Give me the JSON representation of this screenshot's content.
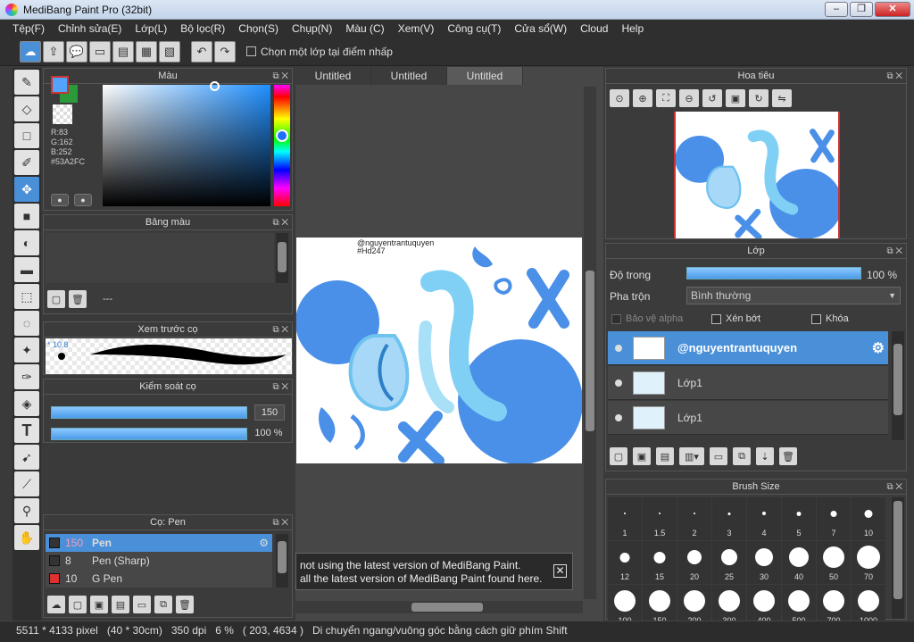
{
  "app": {
    "title": "MediBang Paint Pro (32bit)"
  },
  "menu": [
    "Tệp(F)",
    "Chỉnh sửa(E)",
    "Lớp(L)",
    "Bộ lọc(R)",
    "Chọn(S)",
    "Chụp(N)",
    "Màu (C)",
    "Xem(V)",
    "Công cụ(T)",
    "Cửa sổ(W)",
    "Cloud",
    "Help"
  ],
  "toolbar": {
    "select_layer_label": "Chọn một lớp tại điểm nhấp"
  },
  "panels": {
    "color": {
      "title": "Màu",
      "r": "R:83",
      "g": "G:162",
      "b": "B:252",
      "hex": "#53A2FC",
      "fg_color": "#53a2fc",
      "bg_color": "#2a9a3a"
    },
    "palette": {
      "title": "Bảng màu",
      "info": "---"
    },
    "brush_preview": {
      "title": "Xem trước cọ",
      "size": "* 10.8"
    },
    "brush_control": {
      "title": "Kiểm soát cọ",
      "size_value": "150",
      "opacity_value": "100 %",
      "size_fill": 1.0,
      "opacity_fill": 1.0
    },
    "brush_list": {
      "title": "Cọ: Pen",
      "items": [
        {
          "size": "150",
          "name": "Pen",
          "color": "#333333"
        },
        {
          "size": "8",
          "name": "Pen (Sharp)",
          "color": "#333333"
        },
        {
          "size": "10",
          "name": "G Pen",
          "color": "#e03030"
        }
      ]
    },
    "navigator": {
      "title": "Hoa tiêu"
    },
    "layer": {
      "title": "Lớp",
      "opacity_label": "Độ trong",
      "opacity_value": "100 %",
      "blend_label": "Pha trộn",
      "blend_value": "Bình thường",
      "protect_alpha": "Bảo vệ alpha",
      "clipping": "Xén bớt",
      "lock": "Khóa",
      "rows": [
        {
          "name": "@nguyentrantuquyen"
        },
        {
          "name": "Lớp1"
        },
        {
          "name": "Lớp1"
        }
      ]
    },
    "brush_size": {
      "title": "Brush Size",
      "sizes": [
        "1",
        "1.5",
        "2",
        "3",
        "4",
        "5",
        "7",
        "10",
        "12",
        "15",
        "20",
        "25",
        "30",
        "40",
        "50",
        "70",
        "100",
        "150",
        "200",
        "300",
        "400",
        "500",
        "700",
        "1000"
      ]
    }
  },
  "canvas": {
    "tabs": [
      "Untitled",
      "Untitled",
      "Untitled"
    ],
    "watermark_line1": "@nguyentrantuquyen",
    "watermark_line2": "#Hd247"
  },
  "notice": {
    "line1": "not using the latest version of MediBang Paint.",
    "line2": "all the latest version of MediBang Paint found here."
  },
  "status": {
    "text": "5511 * 4133 pixel   (40 * 30cm)   350 dpi   6 %   ( 203, 4634 )   Di chuyển ngang/vuông góc bằng cách giữ phím Shift"
  }
}
